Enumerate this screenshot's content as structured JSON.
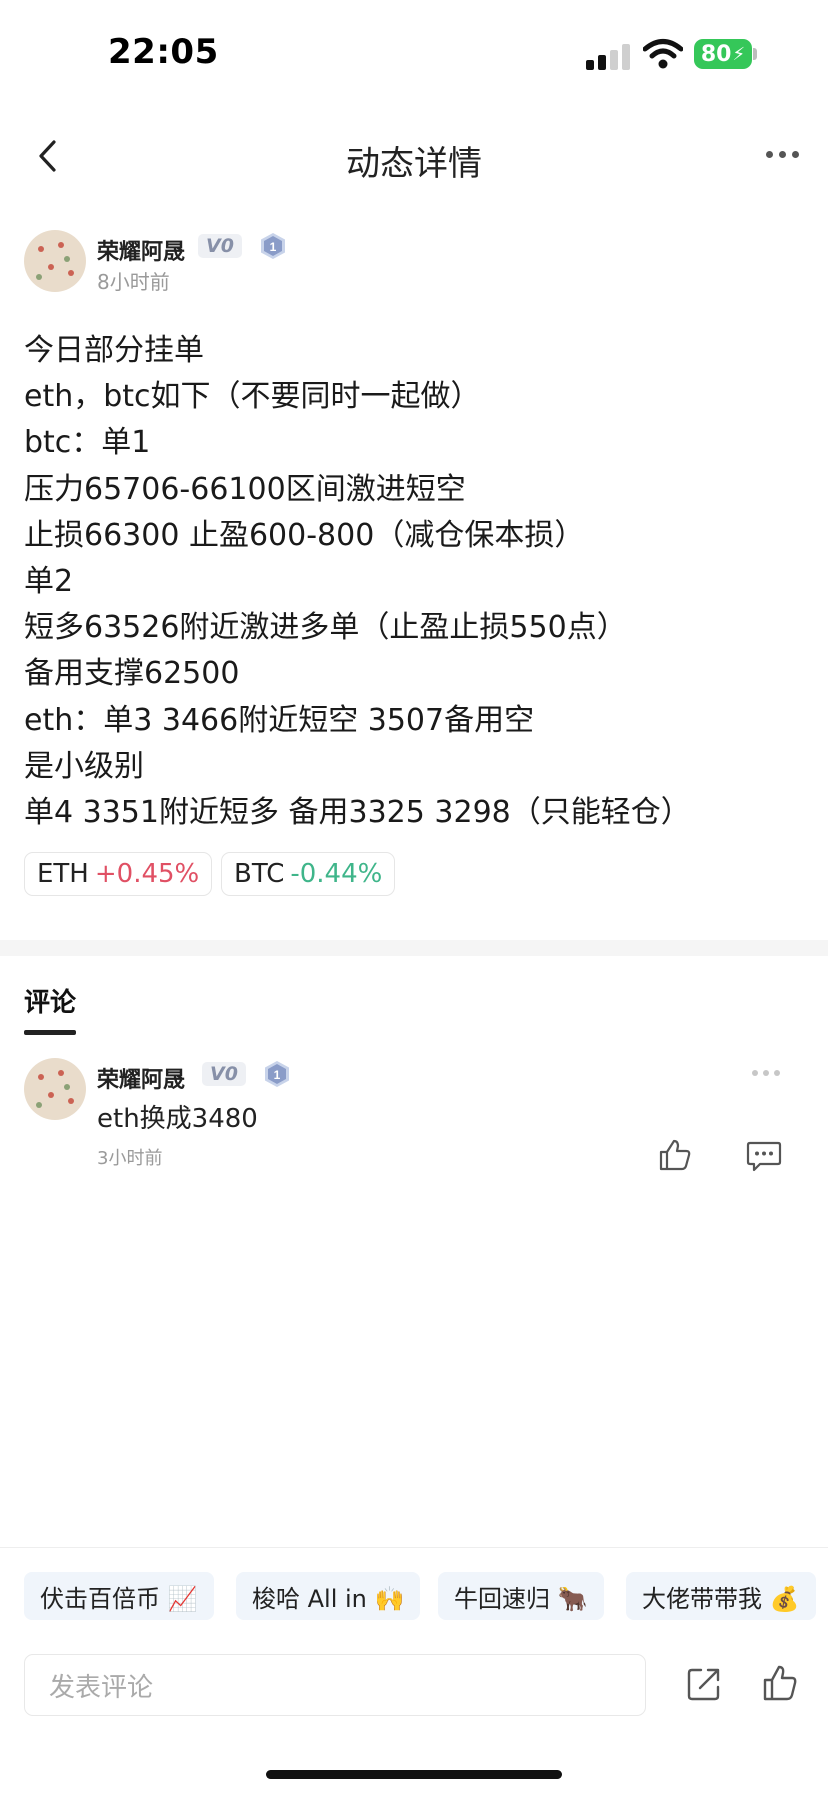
{
  "status_bar": {
    "time": "22:05",
    "battery": "80"
  },
  "header": {
    "title": "动态详情"
  },
  "post": {
    "author": "荣耀阿晟",
    "vip": "V0",
    "level": "1",
    "time": "8小时前",
    "lines": [
      "今日部分挂单",
      "eth，btc如下（不要同时一起做）",
      "btc：单1",
      "压力65706-66100区间激进短空",
      "止损66300 止盈600-800（减仓保本损）",
      "单2",
      "短多63526附近激进多单（止盈止损550点）",
      "备用支撑62500",
      "eth：单3 3466附近短空 3507备用空",
      "是小级别",
      "单4 3351附近短多 备用3325 3298（只能轻仓）"
    ],
    "tickers": [
      {
        "symbol": "ETH",
        "change": "+0.45%",
        "direction": "up"
      },
      {
        "symbol": "BTC",
        "change": "-0.44%",
        "direction": "down"
      }
    ]
  },
  "comments": {
    "tab_label": "评论",
    "items": [
      {
        "author": "荣耀阿晟",
        "vip": "V0",
        "level": "1",
        "text": "eth换成3480",
        "time": "3小时前"
      }
    ]
  },
  "quick_tags": [
    {
      "label": "伏击百倍币 📈"
    },
    {
      "label": "梭哈 All in 🙌"
    },
    {
      "label": "牛回速归 🐂"
    },
    {
      "label": "大佬带带我 💰"
    }
  ],
  "composer": {
    "placeholder": "发表评论"
  },
  "colors": {
    "up": "#e05064",
    "down": "#3fb58a",
    "battery": "#35c759"
  }
}
